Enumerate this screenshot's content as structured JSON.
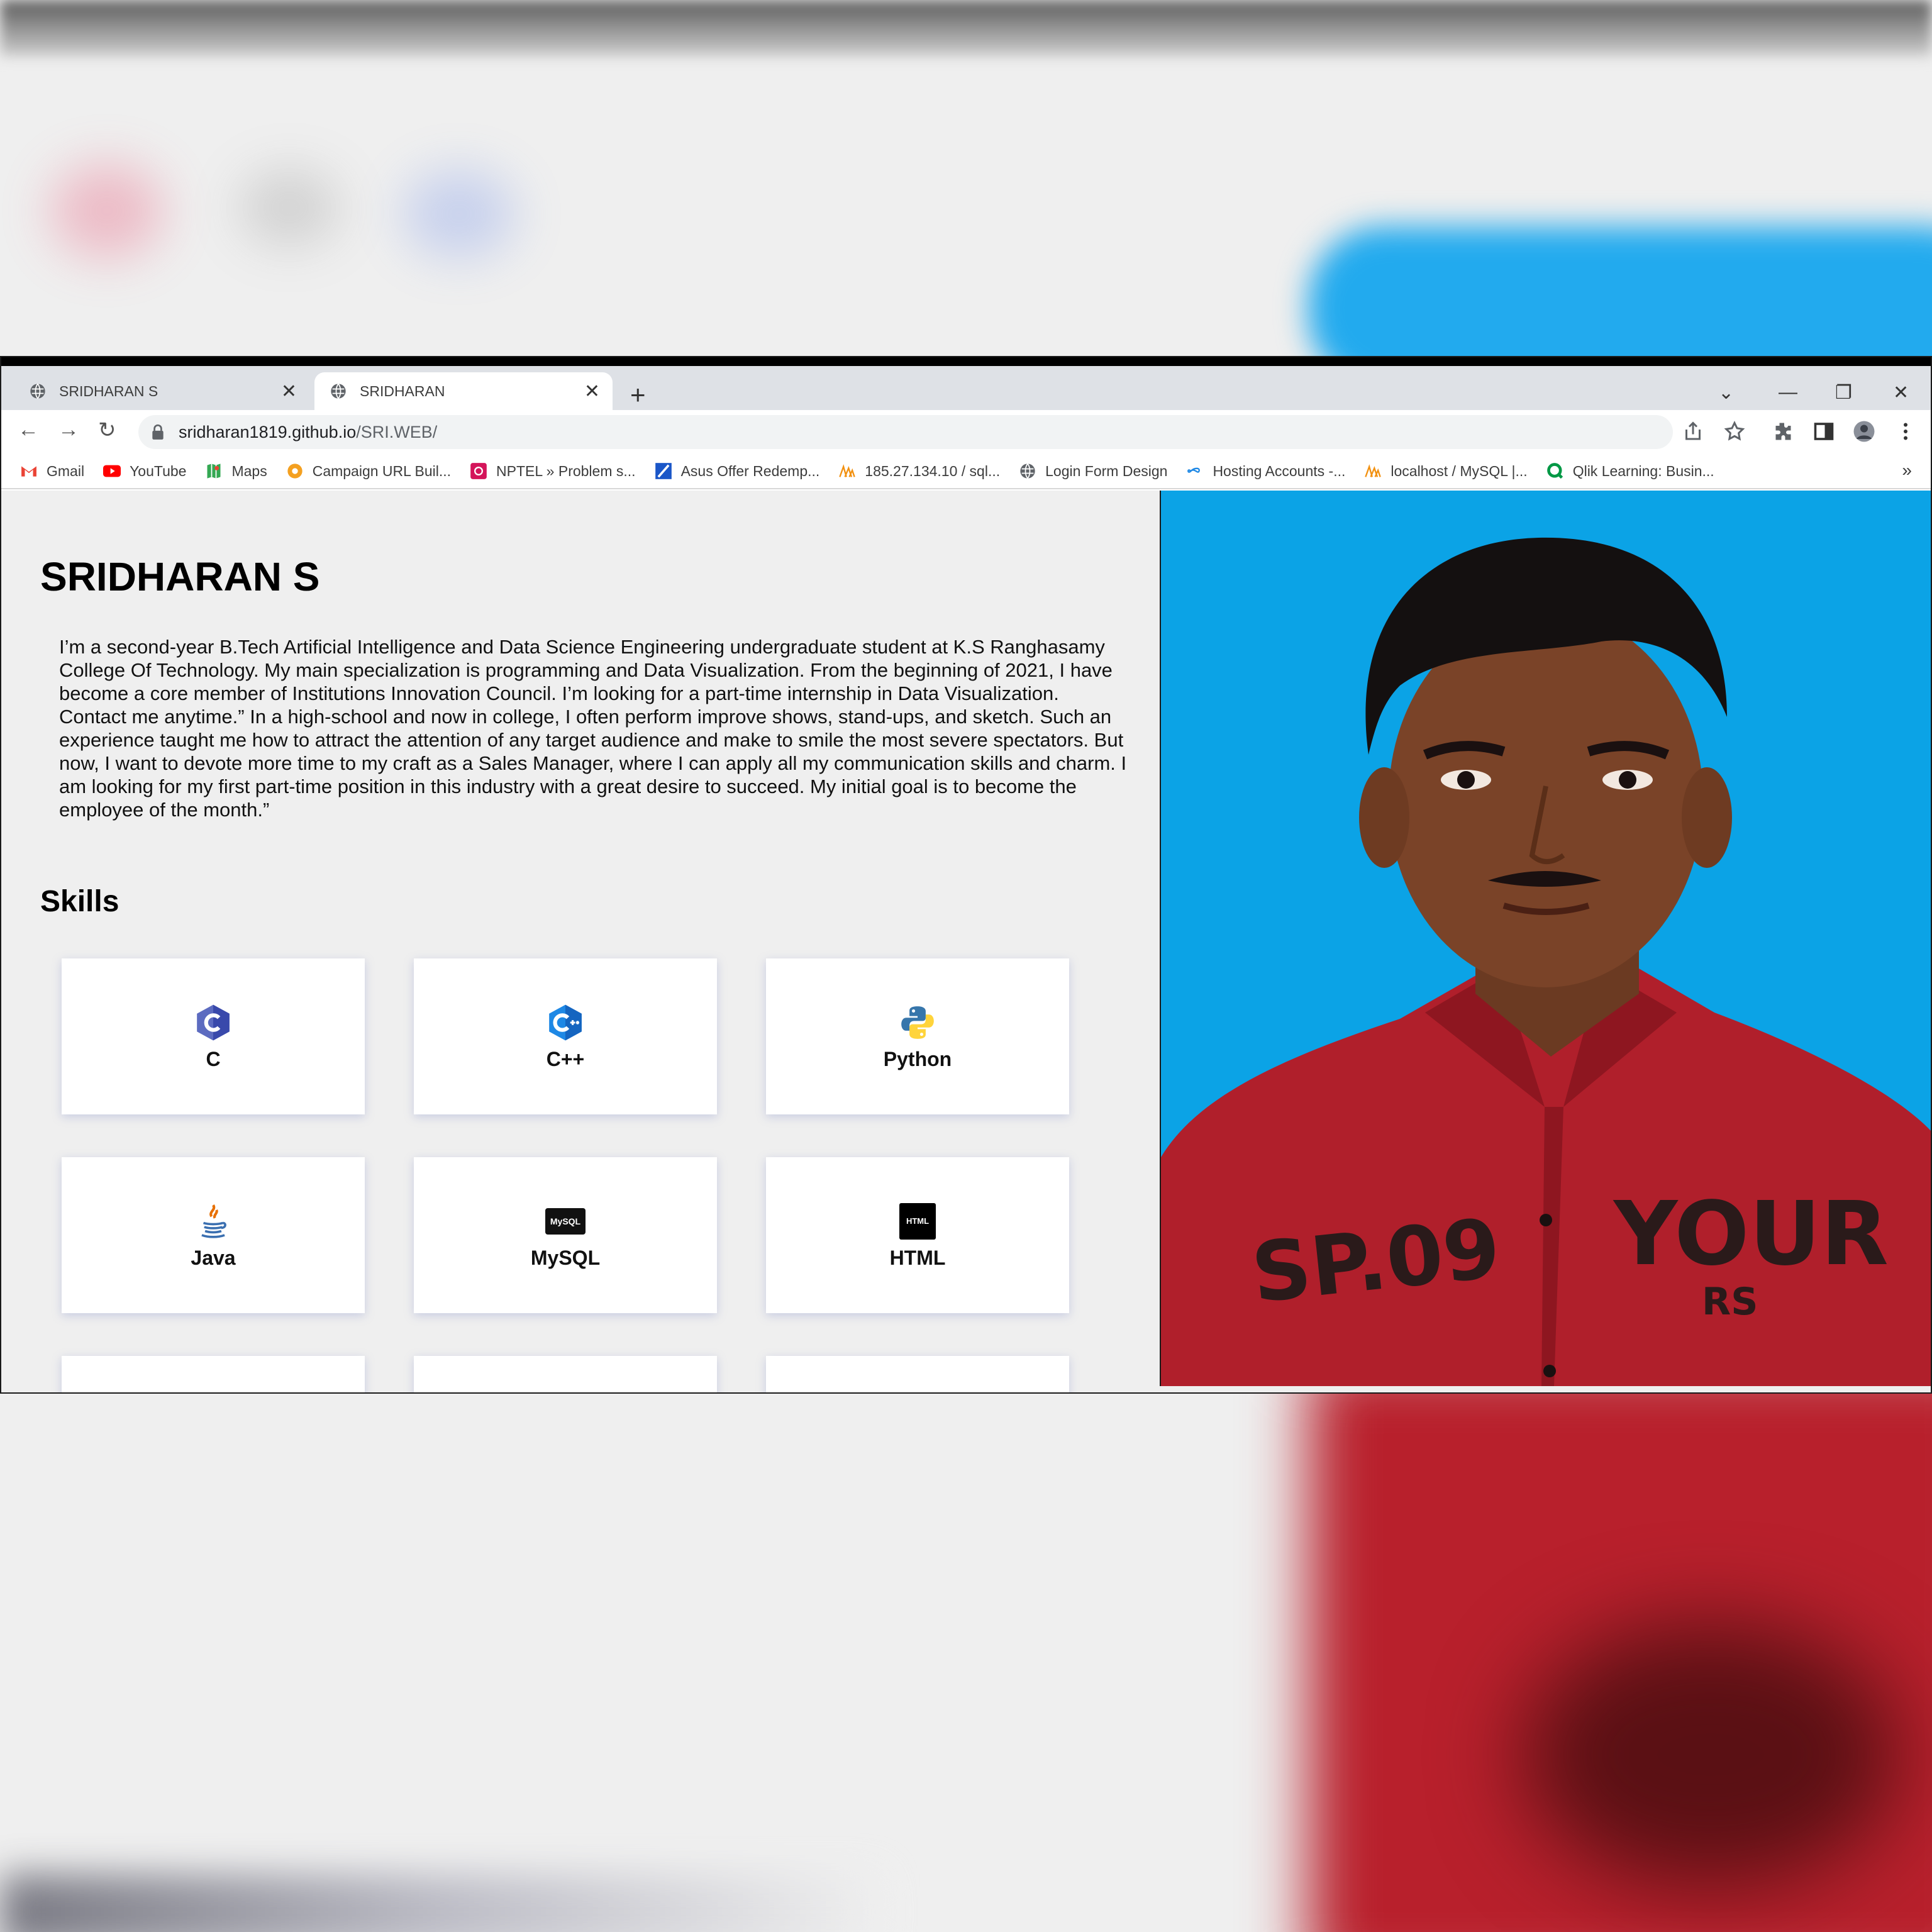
{
  "browser": {
    "tabs": [
      {
        "title": "SRIDHARAN S",
        "active": false
      },
      {
        "title": "SRIDHARAN",
        "active": true
      }
    ],
    "url_host": "sridharan1819.github.io",
    "url_path": "/SRI.WEB/",
    "bookmarks": [
      {
        "label": "Gmail",
        "icon": "gmail-icon"
      },
      {
        "label": "YouTube",
        "icon": "youtube-icon"
      },
      {
        "label": "Maps",
        "icon": "maps-icon"
      },
      {
        "label": "Campaign URL Buil...",
        "icon": "campaign-icon"
      },
      {
        "label": "NPTEL » Problem s...",
        "icon": "nptel-icon"
      },
      {
        "label": "Asus Offer Redemp...",
        "icon": "asus-icon"
      },
      {
        "label": "185.27.134.10 / sql...",
        "icon": "phpmyadmin-icon"
      },
      {
        "label": "Login Form Design",
        "icon": "globe-icon"
      },
      {
        "label": "Hosting Accounts -...",
        "icon": "infinity-icon"
      },
      {
        "label": "localhost / MySQL |...",
        "icon": "phpmyadmin-icon"
      },
      {
        "label": "Qlik Learning: Busin...",
        "icon": "qlik-icon"
      }
    ],
    "more_bookmarks": "»"
  },
  "profile": {
    "name": "SRIDHARAN S",
    "about": "I’m a second-year B.Tech Artificial Intelligence and Data Science Engineering undergraduate student at K.S Ranghasamy College Of Technology. My main specialization is programming and Data Visualization. From the beginning of 2021, I have become a core member of Institutions Innovation Council. I’m looking for a part-time internship in Data Visualization. Contact me anytime.” In a high-school and now in college, I often perform improve shows, stand-ups, and sketch. Such an experience taught me how to attract the attention of any target audience and make to smile the most severe spectators. But now, I want to devote more time to my craft as a Sales Manager, where I can apply all my communication skills and charm. I am looking for my first part-time position in this industry with a great desire to succeed. My initial goal is to become the employee of the month.”"
  },
  "skills": {
    "title": "Skills",
    "items": [
      {
        "label": "C",
        "icon": "c-icon"
      },
      {
        "label": "C++",
        "icon": "cpp-icon"
      },
      {
        "label": "Python",
        "icon": "python-icon"
      },
      {
        "label": "Java",
        "icon": "java-icon"
      },
      {
        "label": "MySQL",
        "icon": "mysql-icon",
        "icon_text": "MySQL"
      },
      {
        "label": "HTML",
        "icon": "html-icon",
        "icon_text": "HTML"
      }
    ]
  },
  "photo": {
    "shirt_text": "SP.09",
    "shirt_text_2": "YOUR",
    "shirt_text_3": "RS"
  },
  "colors": {
    "photo_bg": "#0ba3e6",
    "shirt": "#b8202c",
    "page_bg": "#efefef"
  }
}
